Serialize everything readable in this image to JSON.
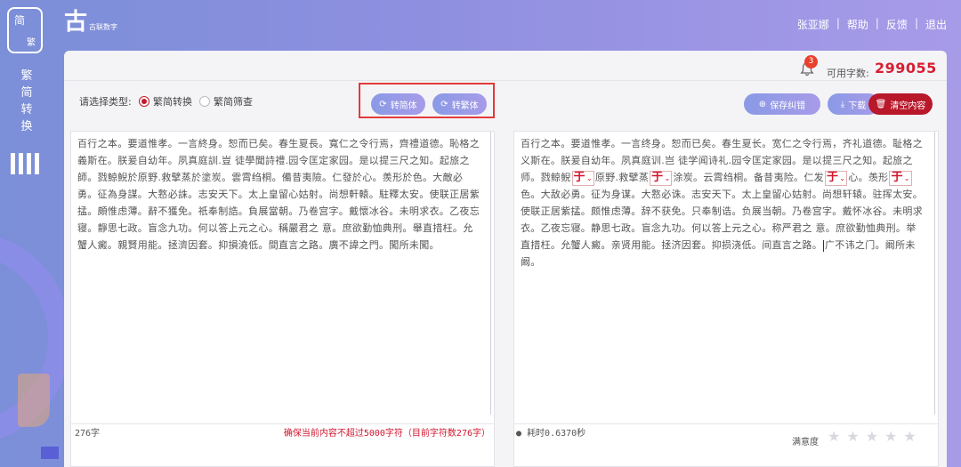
{
  "sidebar": {
    "mode_simplified": "简",
    "mode_traditional": "繁",
    "label_lines": [
      "繁",
      "简",
      "转",
      "换"
    ]
  },
  "logo": {
    "mark": "古",
    "text": "古联数字"
  },
  "header": {
    "user": "张亚娜",
    "links": [
      "帮助",
      "反馈",
      "退出"
    ],
    "separator": "|"
  },
  "status": {
    "notifications": "3",
    "available_label": "可用字数:",
    "available_value": "299055"
  },
  "toolbar": {
    "type_label": "请选择类型:",
    "options": [
      {
        "label": "繁简转换",
        "selected": true
      },
      {
        "label": "繁简筛查",
        "selected": false
      }
    ],
    "to_simplified": "转简体",
    "to_traditional": "转繁体",
    "save_correction": "保存纠错",
    "download": "下载",
    "clear": "清空内容"
  },
  "left_pane": {
    "text": "百行之本。要道惟孝。一言終身。恕而已矣。春生夏長。寬仁之令行焉，齊禮道德。恥格之義斯在。朕爰自幼年。夙真庭訓.豈 徒學聞詩禮.园令匡定家园。是以提三尺之知。起旅之師。戮鯨鯢於原野.救擘蒸於塗炭。雲霄绉桐。備昔夷險。仁發於心。羨形於色。大敵必勇。征為身謀。大憝必誅。志安天下。太上皇留心姑射。尚想軒轅。駐釋太安。使联正居紫掹。頗惟虑薄。辭不獲免。祇奉制誥。負展當朝。乃卷宫字。戴懷冰谷。未明求衣。乙夜忘寝。靜思七政。盲念九功。何以答上元之心。稱嚴君之 意。庶欲勤恤典刑。舉直措枉。允蟹人癜。親賢用能。拯濟因套。抑損澆低。間直言之路。廣不諱之門。闖所未闖。",
    "char_count": "276字",
    "warning": "确保当前内容不超过5000字符（目前字符数276字）"
  },
  "right_pane": {
    "seg1": "百行之本。要道惟孝。一言终身。恕而已矣。春生夏长。宽仁之令行焉，齐礼道德。耻格之义斯在。朕爰自幼年。夙真庭训.岂 徒学闻诗礼.园令匡定家园。是以提三尺之知。起旅之师。戮鲸鲵",
    "v1": "于",
    "seg2": "原野.救擘蒸",
    "v2": "于",
    "seg3": "涂炭。云霄绉桐。备昔夷险。仁发",
    "v3": "于",
    "seg4": "心。羡形",
    "v4": "于",
    "seg5": "色。大敌必勇。征为身谋。大憝必诛。志安天下。太上皇留心姑射。尚想轩辕。驻挥太安。使联正居紫掹。颇惟虑薄。辞不获免。只奉制诰。负展当朝。乃卷宫字。戴怀冰谷。未明求衣。乙夜忘寝。静思七政。盲念九功。何以答上元之心。称严君之 意。庶欲勤恤典刑。举直措枉。允蟹人癜。亲贤用能。拯济因套。抑损浇低。间直言之路。",
    "seg6": "广不讳之门。阚所未阚。",
    "elapsed": "耗时0.6370秒",
    "rating_label": "满意度",
    "stars": 5
  }
}
